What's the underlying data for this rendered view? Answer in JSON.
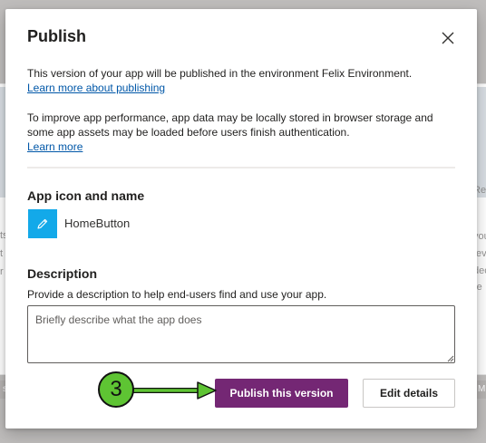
{
  "background": {
    "left_texts": [
      "ts",
      "t",
      "r"
    ],
    "right_texts": [
      "Re",
      "vou",
      "tev",
      "dec",
      "re"
    ],
    "left_tag": "s",
    "right_tag": "M"
  },
  "modal": {
    "title": "Publish",
    "close_label": "Close",
    "publish_info": "This version of your app will be published in the environment Felix Environment.",
    "publish_link": "Learn more about publishing",
    "performance_info": "To improve app performance, app data may be locally stored in browser storage and some app assets may be loaded before users finish authentication.",
    "performance_link": "Learn more",
    "app_section_title": "App icon and name",
    "app_name": "HomeButton",
    "description_title": "Description",
    "description_help": "Provide a description to help end-users find and use your app.",
    "description_placeholder": "Briefly describe what the app does",
    "description_value": "",
    "publish_button": "Publish this version",
    "edit_button": "Edit details"
  },
  "annotation": {
    "step_number": "3"
  },
  "colors": {
    "primary_button": "#742774",
    "app_icon": "#13a9e9",
    "link": "#0057a8",
    "step_badge": "#5ec433"
  },
  "icons": {
    "app_icon": "pencil-icon",
    "close": "close-icon",
    "arrow": "arrow-right-icon"
  }
}
